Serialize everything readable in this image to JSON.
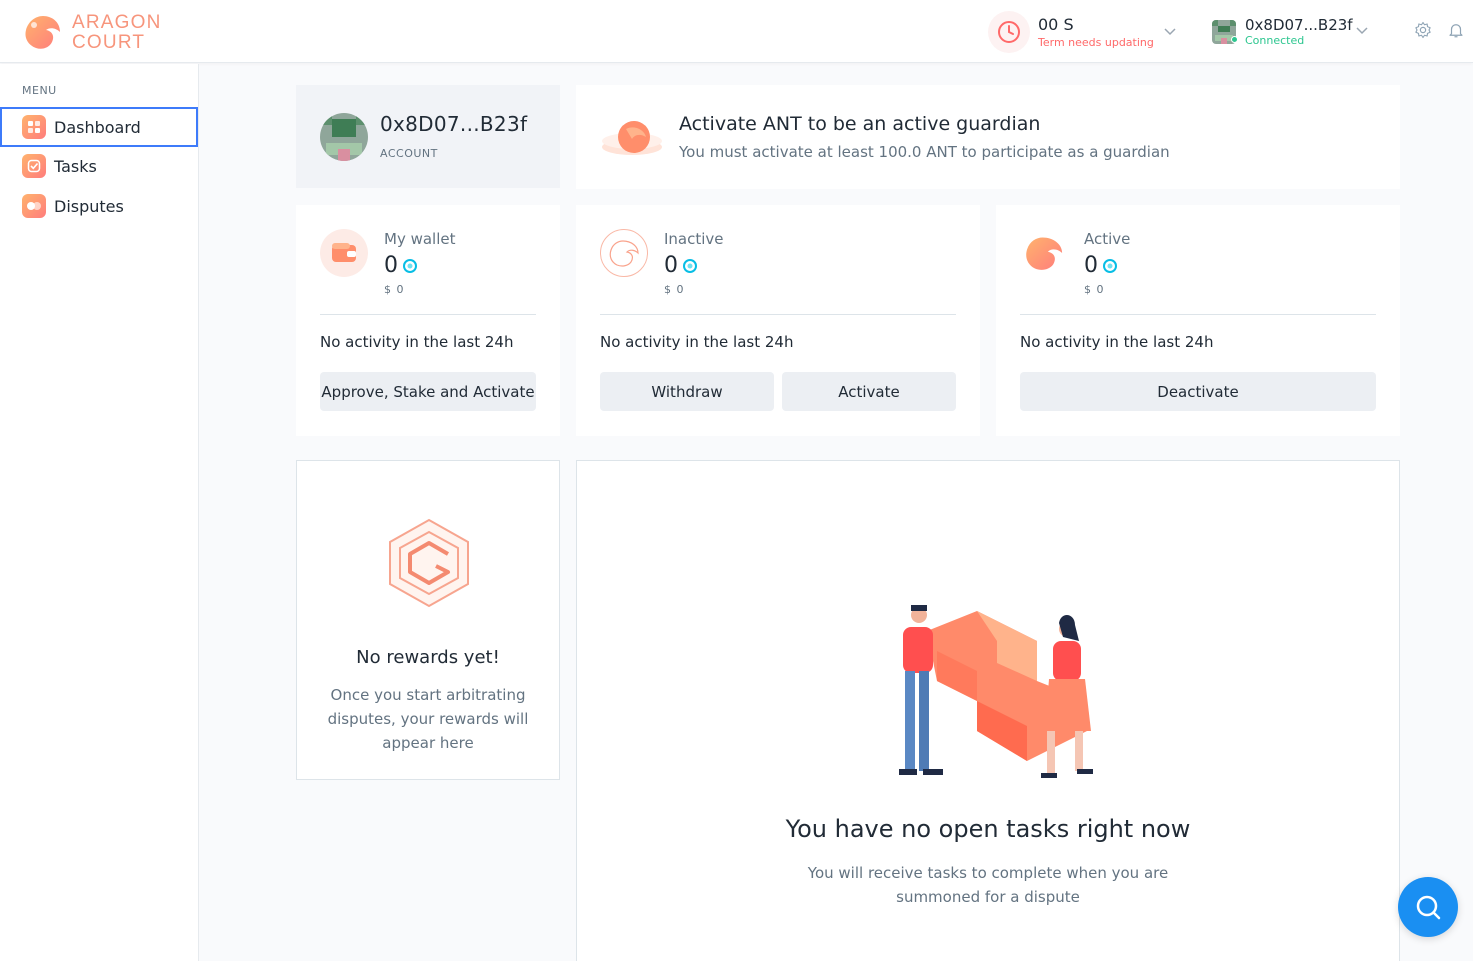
{
  "app": {
    "name_line1": "ARAGON",
    "name_line2": "COURT",
    "brand_color": "#f7957c"
  },
  "header": {
    "term_value": "00 S",
    "term_status": "Term needs updating",
    "account_address": "0x8D07...B23f",
    "account_status": "Connected",
    "icons": [
      "clock-icon",
      "chevron-down-icon",
      "gear-icon",
      "bell-icon"
    ]
  },
  "sidebar": {
    "menu_label": "MENU",
    "items": [
      {
        "label": "Dashboard",
        "icon": "dashboard-icon",
        "active": true
      },
      {
        "label": "Tasks",
        "icon": "tasks-icon",
        "active": false
      },
      {
        "label": "Disputes",
        "icon": "disputes-icon",
        "active": false
      }
    ]
  },
  "account_card": {
    "address": "0x8D07...B23f",
    "label": "ACCOUNT"
  },
  "banner": {
    "title": "Activate ANT to be an active guardian",
    "subtitle": "You must activate at least 100.0 ANT to participate as a guardian"
  },
  "balances": [
    {
      "label": "My wallet",
      "value": "0",
      "usd": "$ 0",
      "activity": "No activity in the last 24h",
      "buttons": [
        "Approve, Stake and Activate"
      ]
    },
    {
      "label": "Inactive",
      "value": "0",
      "usd": "$ 0",
      "activity": "No activity in the last 24h",
      "buttons": [
        "Withdraw",
        "Activate"
      ]
    },
    {
      "label": "Active",
      "value": "0",
      "usd": "$ 0",
      "activity": "No activity in the last 24h",
      "buttons": [
        "Deactivate"
      ]
    }
  ],
  "rewards": {
    "title": "No rewards yet!",
    "subtitle": "Once you start arbitrating disputes, your rewards will appear here"
  },
  "tasks": {
    "title": "You have no open tasks right now",
    "subtitle": "You will receive tasks to complete when you are summoned for a dispute"
  },
  "colors": {
    "accent": "#3e7bfa",
    "danger": "#ff6969",
    "success": "#2cc68f",
    "help": "#1a8ff2",
    "ant": "#08bee5"
  }
}
